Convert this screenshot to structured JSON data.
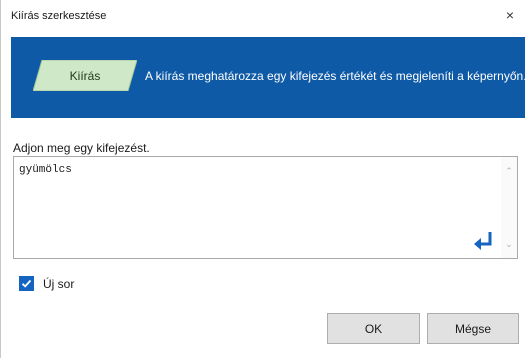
{
  "window": {
    "title": "Kiírás szerkesztése",
    "close_glyph": "×"
  },
  "banner": {
    "background": "#0f5aa6",
    "block_label": "Kiírás",
    "block_color": "#cfe8c8",
    "description": "A kiírás meghatározza egy kifejezés értékét és megjeleníti a képernyőn."
  },
  "expression": {
    "prompt": "Adjon meg egy kifejezést.",
    "value": "gyümölcs"
  },
  "newline_option": {
    "label": "Új sor",
    "checked": true
  },
  "buttons": {
    "ok": "OK",
    "cancel": "Mégse"
  }
}
